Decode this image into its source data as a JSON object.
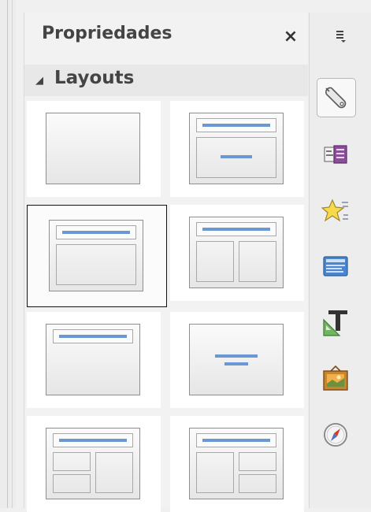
{
  "panel": {
    "title": "Propriedades",
    "close_glyph": "×"
  },
  "section": {
    "expander_glyph": "◢",
    "title": "Layouts"
  },
  "layouts": [
    {
      "name": "blank-slide",
      "selected": false
    },
    {
      "name": "title-content",
      "selected": false
    },
    {
      "name": "title-content-box",
      "selected": true
    },
    {
      "name": "title-two-content",
      "selected": false
    },
    {
      "name": "title-only",
      "selected": false
    },
    {
      "name": "centered-text",
      "selected": false
    },
    {
      "name": "title-two-content-and-content",
      "selected": false
    },
    {
      "name": "title-content-and-two-content",
      "selected": false
    }
  ],
  "sidebar_deck": {
    "menu_icon": "hamburger-menu-icon",
    "buttons": [
      {
        "icon": "wrench-properties-icon",
        "active": true
      },
      {
        "icon": "slide-transition-icon",
        "active": false
      },
      {
        "icon": "animation-star-icon",
        "active": false
      },
      {
        "icon": "master-slides-icon",
        "active": false
      },
      {
        "icon": "styles-format-icon",
        "active": false
      },
      {
        "icon": "gallery-picture-icon",
        "active": false
      },
      {
        "icon": "navigator-compass-icon",
        "active": false
      }
    ]
  },
  "colors": {
    "placeholder_line": "#6b97d3",
    "selected_border": "#111111",
    "title_text": "#444444"
  }
}
